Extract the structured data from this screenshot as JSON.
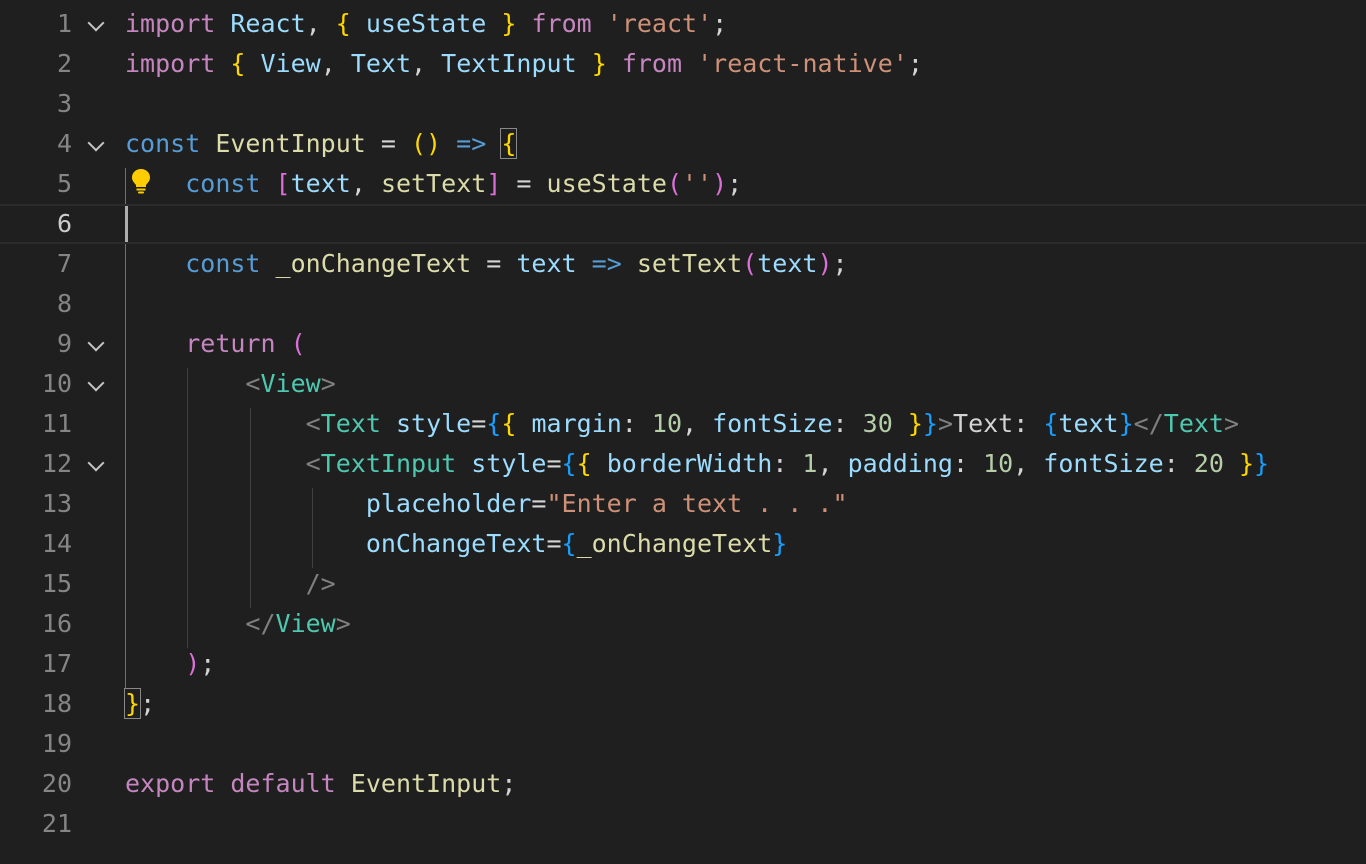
{
  "editor": {
    "language": "javascript",
    "current_line": 6,
    "colors": {
      "background": "#1f1f1f",
      "keyword": "#569cd6",
      "control_keyword": "#c586c0",
      "variable": "#9cdcfe",
      "function": "#dcdcaa",
      "string": "#ce9178",
      "number": "#b5cea8",
      "tag": "#4ec9b0",
      "bracket_1": "#ffd700",
      "bracket_2": "#da70d6",
      "bracket_3": "#179fff"
    },
    "icons": [
      "fold-chevron-icon",
      "lightbulb-icon"
    ],
    "lines": [
      {
        "number": "1",
        "foldable": true,
        "tokens": [
          {
            "t": "import",
            "c": "kw-ctrl"
          },
          {
            "t": " ",
            "c": ""
          },
          {
            "t": "React",
            "c": "var"
          },
          {
            "t": ", ",
            "c": "txt"
          },
          {
            "t": "{",
            "c": "b1"
          },
          {
            "t": " ",
            "c": ""
          },
          {
            "t": "useState",
            "c": "var"
          },
          {
            "t": " ",
            "c": ""
          },
          {
            "t": "}",
            "c": "b1"
          },
          {
            "t": " ",
            "c": ""
          },
          {
            "t": "from",
            "c": "kw-ctrl"
          },
          {
            "t": " ",
            "c": ""
          },
          {
            "t": "'react'",
            "c": "str"
          },
          {
            "t": ";",
            "c": "txt"
          }
        ]
      },
      {
        "number": "2",
        "foldable": false,
        "tokens": [
          {
            "t": "import",
            "c": "kw-ctrl"
          },
          {
            "t": " ",
            "c": ""
          },
          {
            "t": "{",
            "c": "b1"
          },
          {
            "t": " ",
            "c": ""
          },
          {
            "t": "View",
            "c": "var"
          },
          {
            "t": ", ",
            "c": "txt"
          },
          {
            "t": "Text",
            "c": "var"
          },
          {
            "t": ", ",
            "c": "txt"
          },
          {
            "t": "TextInput",
            "c": "var"
          },
          {
            "t": " ",
            "c": ""
          },
          {
            "t": "}",
            "c": "b1"
          },
          {
            "t": " ",
            "c": ""
          },
          {
            "t": "from",
            "c": "kw-ctrl"
          },
          {
            "t": " ",
            "c": ""
          },
          {
            "t": "'react-native'",
            "c": "str"
          },
          {
            "t": ";",
            "c": "txt"
          }
        ]
      },
      {
        "number": "3",
        "foldable": false,
        "tokens": []
      },
      {
        "number": "4",
        "foldable": true,
        "tokens": [
          {
            "t": "const",
            "c": "kw"
          },
          {
            "t": " ",
            "c": ""
          },
          {
            "t": "EventInput",
            "c": "fn"
          },
          {
            "t": " = ",
            "c": "txt"
          },
          {
            "t": "()",
            "c": "b1"
          },
          {
            "t": " ",
            "c": ""
          },
          {
            "t": "=>",
            "c": "kw"
          },
          {
            "t": " ",
            "c": ""
          },
          {
            "t": "{",
            "c": "b1 bracket-box"
          }
        ]
      },
      {
        "number": "5",
        "foldable": false,
        "tokens": [
          {
            "t": "    ",
            "c": ""
          },
          {
            "t": "const",
            "c": "kw"
          },
          {
            "t": " ",
            "c": ""
          },
          {
            "t": "[",
            "c": "b2"
          },
          {
            "t": "text",
            "c": "var"
          },
          {
            "t": ", ",
            "c": "txt"
          },
          {
            "t": "setText",
            "c": "fn"
          },
          {
            "t": "]",
            "c": "b2"
          },
          {
            "t": " = ",
            "c": "txt"
          },
          {
            "t": "useState",
            "c": "fn"
          },
          {
            "t": "(",
            "c": "b2"
          },
          {
            "t": "''",
            "c": "str"
          },
          {
            "t": ")",
            "c": "b2"
          },
          {
            "t": ";",
            "c": "txt"
          }
        ]
      },
      {
        "number": "6",
        "foldable": false,
        "tokens": []
      },
      {
        "number": "7",
        "foldable": false,
        "tokens": [
          {
            "t": "    ",
            "c": ""
          },
          {
            "t": "const",
            "c": "kw"
          },
          {
            "t": " ",
            "c": ""
          },
          {
            "t": "_onChangeText",
            "c": "fn"
          },
          {
            "t": " = ",
            "c": "txt"
          },
          {
            "t": "text",
            "c": "var"
          },
          {
            "t": " ",
            "c": ""
          },
          {
            "t": "=>",
            "c": "kw"
          },
          {
            "t": " ",
            "c": ""
          },
          {
            "t": "setText",
            "c": "fn"
          },
          {
            "t": "(",
            "c": "b2"
          },
          {
            "t": "text",
            "c": "var"
          },
          {
            "t": ")",
            "c": "b2"
          },
          {
            "t": ";",
            "c": "txt"
          }
        ]
      },
      {
        "number": "8",
        "foldable": false,
        "tokens": []
      },
      {
        "number": "9",
        "foldable": true,
        "tokens": [
          {
            "t": "    ",
            "c": ""
          },
          {
            "t": "return",
            "c": "kw-ctrl"
          },
          {
            "t": " ",
            "c": ""
          },
          {
            "t": "(",
            "c": "b2"
          }
        ]
      },
      {
        "number": "10",
        "foldable": true,
        "tokens": [
          {
            "t": "        ",
            "c": ""
          },
          {
            "t": "<",
            "c": "ang"
          },
          {
            "t": "View",
            "c": "tag"
          },
          {
            "t": ">",
            "c": "ang"
          }
        ]
      },
      {
        "number": "11",
        "foldable": false,
        "tokens": [
          {
            "t": "            ",
            "c": ""
          },
          {
            "t": "<",
            "c": "ang"
          },
          {
            "t": "Text",
            "c": "tag"
          },
          {
            "t": " ",
            "c": ""
          },
          {
            "t": "style",
            "c": "var"
          },
          {
            "t": "=",
            "c": "txt"
          },
          {
            "t": "{",
            "c": "b3"
          },
          {
            "t": "{",
            "c": "b1"
          },
          {
            "t": " ",
            "c": ""
          },
          {
            "t": "margin",
            "c": "var"
          },
          {
            "t": ": ",
            "c": "txt"
          },
          {
            "t": "10",
            "c": "num"
          },
          {
            "t": ", ",
            "c": "txt"
          },
          {
            "t": "fontSize",
            "c": "var"
          },
          {
            "t": ": ",
            "c": "txt"
          },
          {
            "t": "30",
            "c": "num"
          },
          {
            "t": " ",
            "c": ""
          },
          {
            "t": "}",
            "c": "b1"
          },
          {
            "t": "}",
            "c": "b3"
          },
          {
            "t": ">",
            "c": "ang"
          },
          {
            "t": "Text: ",
            "c": "txt"
          },
          {
            "t": "{",
            "c": "b3"
          },
          {
            "t": "text",
            "c": "var"
          },
          {
            "t": "}",
            "c": "b3"
          },
          {
            "t": "</",
            "c": "ang"
          },
          {
            "t": "Text",
            "c": "tag"
          },
          {
            "t": ">",
            "c": "ang"
          }
        ]
      },
      {
        "number": "12",
        "foldable": true,
        "tokens": [
          {
            "t": "            ",
            "c": ""
          },
          {
            "t": "<",
            "c": "ang"
          },
          {
            "t": "TextInput",
            "c": "tag"
          },
          {
            "t": " ",
            "c": ""
          },
          {
            "t": "style",
            "c": "var"
          },
          {
            "t": "=",
            "c": "txt"
          },
          {
            "t": "{",
            "c": "b3"
          },
          {
            "t": "{",
            "c": "b1"
          },
          {
            "t": " ",
            "c": ""
          },
          {
            "t": "borderWidth",
            "c": "var"
          },
          {
            "t": ": ",
            "c": "txt"
          },
          {
            "t": "1",
            "c": "num"
          },
          {
            "t": ", ",
            "c": "txt"
          },
          {
            "t": "padding",
            "c": "var"
          },
          {
            "t": ": ",
            "c": "txt"
          },
          {
            "t": "10",
            "c": "num"
          },
          {
            "t": ", ",
            "c": "txt"
          },
          {
            "t": "fontSize",
            "c": "var"
          },
          {
            "t": ": ",
            "c": "txt"
          },
          {
            "t": "20",
            "c": "num"
          },
          {
            "t": " ",
            "c": ""
          },
          {
            "t": "}",
            "c": "b1"
          },
          {
            "t": "}",
            "c": "b3"
          }
        ]
      },
      {
        "number": "13",
        "foldable": false,
        "tokens": [
          {
            "t": "                ",
            "c": ""
          },
          {
            "t": "placeholder",
            "c": "var"
          },
          {
            "t": "=",
            "c": "txt"
          },
          {
            "t": "\"Enter a text . . .\"",
            "c": "str"
          }
        ]
      },
      {
        "number": "14",
        "foldable": false,
        "tokens": [
          {
            "t": "                ",
            "c": ""
          },
          {
            "t": "onChangeText",
            "c": "var"
          },
          {
            "t": "=",
            "c": "txt"
          },
          {
            "t": "{",
            "c": "b3"
          },
          {
            "t": "_onChangeText",
            "c": "fn"
          },
          {
            "t": "}",
            "c": "b3"
          }
        ]
      },
      {
        "number": "15",
        "foldable": false,
        "tokens": [
          {
            "t": "            ",
            "c": ""
          },
          {
            "t": "/>",
            "c": "ang"
          }
        ]
      },
      {
        "number": "16",
        "foldable": false,
        "tokens": [
          {
            "t": "        ",
            "c": ""
          },
          {
            "t": "</",
            "c": "ang"
          },
          {
            "t": "View",
            "c": "tag"
          },
          {
            "t": ">",
            "c": "ang"
          }
        ]
      },
      {
        "number": "17",
        "foldable": false,
        "tokens": [
          {
            "t": "    ",
            "c": ""
          },
          {
            "t": ")",
            "c": "b2"
          },
          {
            "t": ";",
            "c": "txt"
          }
        ]
      },
      {
        "number": "18",
        "foldable": false,
        "tokens": [
          {
            "t": "}",
            "c": "b1 bracket-box"
          },
          {
            "t": ";",
            "c": "txt"
          }
        ]
      },
      {
        "number": "19",
        "foldable": false,
        "tokens": []
      },
      {
        "number": "20",
        "foldable": false,
        "tokens": [
          {
            "t": "export",
            "c": "kw-ctrl"
          },
          {
            "t": " ",
            "c": ""
          },
          {
            "t": "default",
            "c": "kw-ctrl"
          },
          {
            "t": " ",
            "c": ""
          },
          {
            "t": "EventInput",
            "c": "fn"
          },
          {
            "t": ";",
            "c": "txt"
          }
        ]
      },
      {
        "number": "21",
        "foldable": false,
        "tokens": []
      }
    ]
  }
}
